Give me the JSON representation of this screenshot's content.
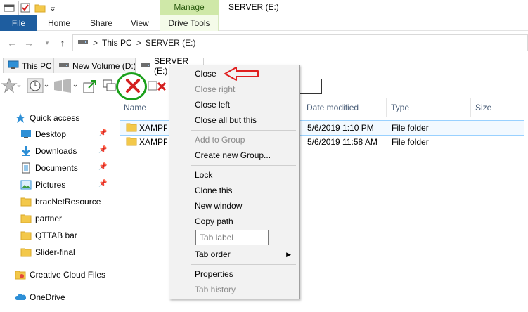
{
  "titlebar": {
    "manage_label": "Manage",
    "title": "SERVER (E:)",
    "qat_icons": [
      "app-icon",
      "properties-check-icon",
      "new-folder-icon",
      "customize-qat-icon"
    ]
  },
  "ribbon": {
    "file_label": "File",
    "tabs": [
      "Home",
      "Share",
      "View"
    ],
    "drive_tools_label": "Drive Tools"
  },
  "address": {
    "segments": [
      "This PC",
      "SERVER (E:)"
    ],
    "separator": ">"
  },
  "qttabs": [
    {
      "label": "This PC",
      "icon": "this-pc-icon"
    },
    {
      "label": "New Volume (D:)",
      "icon": "drive-icon"
    },
    {
      "label": "SERVER (E:)",
      "icon": "drive-icon"
    }
  ],
  "sidebar": {
    "quick_access": "Quick access",
    "items": [
      {
        "label": "Desktop",
        "pinned": true,
        "icon": "desktop-icon"
      },
      {
        "label": "Downloads",
        "pinned": true,
        "icon": "downloads-icon"
      },
      {
        "label": "Documents",
        "pinned": true,
        "icon": "documents-icon"
      },
      {
        "label": "Pictures",
        "pinned": true,
        "icon": "pictures-icon"
      },
      {
        "label": "bracNetResource",
        "pinned": false,
        "icon": "folder-icon"
      },
      {
        "label": "partner",
        "pinned": false,
        "icon": "folder-icon"
      },
      {
        "label": "QTTAB bar",
        "pinned": false,
        "icon": "folder-icon"
      },
      {
        "label": "Slider-final",
        "pinned": false,
        "icon": "folder-icon"
      }
    ],
    "creative_cloud": "Creative Cloud Files",
    "onedrive": "OneDrive"
  },
  "filelist": {
    "columns": [
      "Name",
      "Date modified",
      "Type",
      "Size"
    ],
    "rows": [
      {
        "name": "XAMPP7",
        "date": "5/6/2019 1:10 PM",
        "type": "File folder",
        "selected": true
      },
      {
        "name": "XAMPP7",
        "date": "5/6/2019 11:58 AM",
        "type": "File folder",
        "selected": false
      }
    ]
  },
  "context_menu": {
    "items": [
      {
        "label": "Close",
        "disabled": false
      },
      {
        "label": "Close right",
        "disabled": true
      },
      {
        "label": "Close left",
        "disabled": false
      },
      {
        "label": "Close all but this",
        "disabled": false
      },
      {
        "label": "Add to Group",
        "disabled": true
      },
      {
        "label": "Create new Group...",
        "disabled": false
      },
      {
        "label": "Lock",
        "disabled": false
      },
      {
        "label": "Clone this",
        "disabled": false
      },
      {
        "label": "New window",
        "disabled": false
      },
      {
        "label": "Copy path",
        "disabled": false
      },
      {
        "label": "Tab order",
        "disabled": false
      },
      {
        "label": "Properties",
        "disabled": false
      },
      {
        "label": "Tab history",
        "disabled": true
      }
    ],
    "tab_label_placeholder": "Tab label"
  },
  "colors": {
    "file_tab": "#1e5d9f",
    "manage_tab": "#cfe8a8",
    "annotation_red": "#e02020",
    "annotation_green": "#1aa01a",
    "close_x_red": "#d42020"
  }
}
